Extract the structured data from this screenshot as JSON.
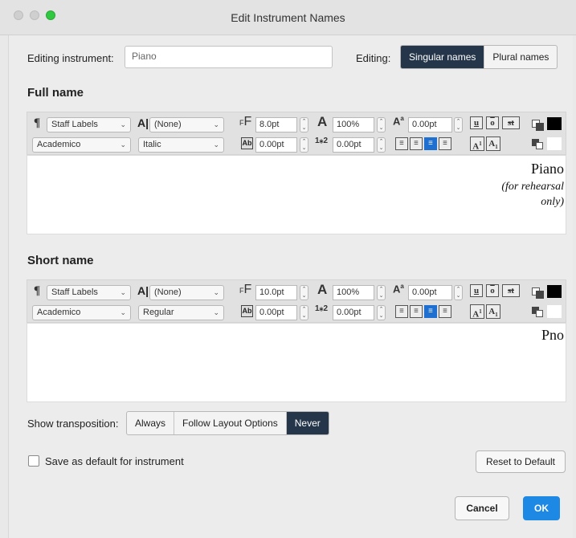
{
  "window": {
    "title": "Edit Instrument Names"
  },
  "editing_instrument": {
    "label": "Editing instrument:",
    "value": "Piano"
  },
  "editing_mode": {
    "label": "Editing:",
    "singular": "Singular names",
    "plural": "Plural names",
    "selected": "singular"
  },
  "full_name": {
    "heading": "Full name",
    "toolbar": {
      "paragraph_style": "Staff Labels",
      "char_style": "(None)",
      "font": "Academico",
      "font_style": "Italic",
      "font_size": "8.0pt",
      "scale": "100%",
      "baseline": "0.00pt",
      "tracking": "0.00pt",
      "line_spacing": "0.00pt"
    },
    "text_lines": [
      "Piano",
      "(for rehearsal",
      "only)"
    ]
  },
  "short_name": {
    "heading": "Short name",
    "toolbar": {
      "paragraph_style": "Staff Labels",
      "char_style": "(None)",
      "font": "Academico",
      "font_style": "Regular",
      "font_size": "10.0pt",
      "scale": "100%",
      "baseline": "0.00pt",
      "tracking": "0.00pt",
      "line_spacing": "0.00pt"
    },
    "text_lines": [
      "Pno"
    ]
  },
  "transposition": {
    "label": "Show transposition:",
    "options": [
      "Always",
      "Follow Layout Options",
      "Never"
    ],
    "selected": "Never"
  },
  "save_default": {
    "label": "Save as default for instrument",
    "checked": false
  },
  "buttons": {
    "reset": "Reset to Default",
    "cancel": "Cancel",
    "ok": "OK"
  },
  "colors": {
    "accent": "#1e88e5",
    "selected_segment": "#25364a"
  }
}
